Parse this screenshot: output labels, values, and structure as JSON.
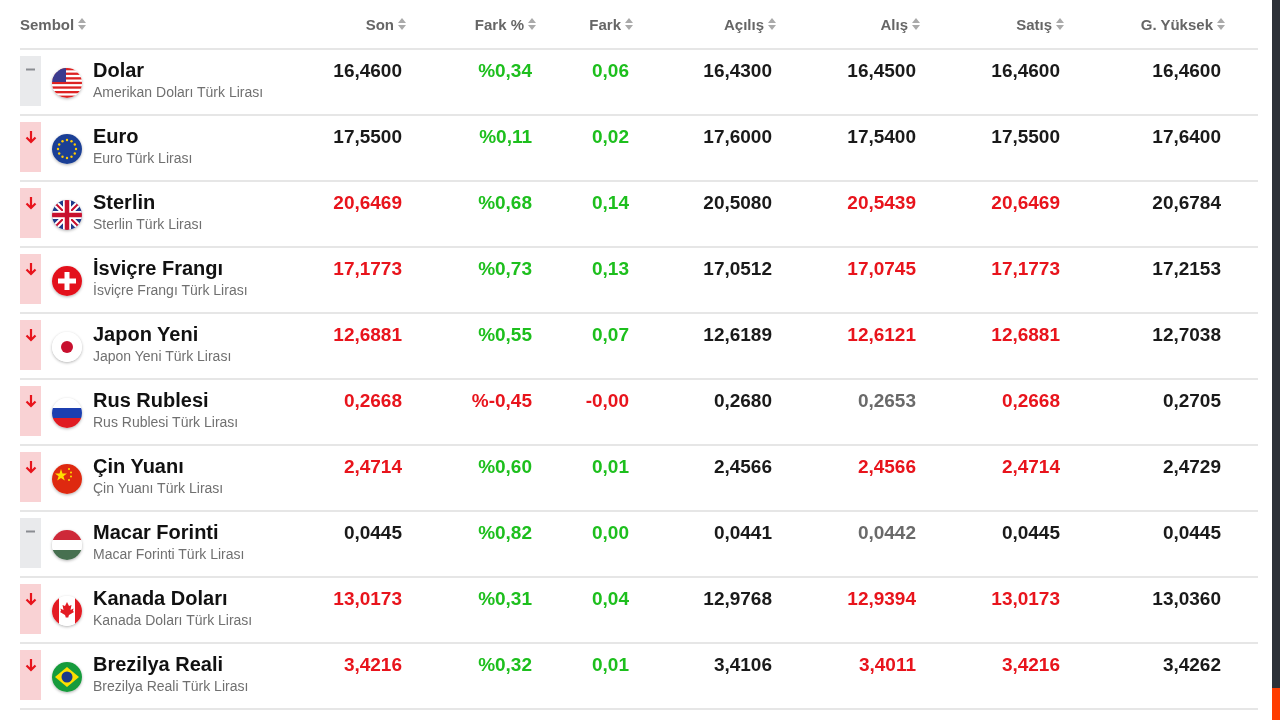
{
  "table": {
    "columns": [
      {
        "label": "Sembol"
      },
      {
        "label": "Son"
      },
      {
        "label": "Fark %"
      },
      {
        "label": "Fark"
      },
      {
        "label": "Açılış"
      },
      {
        "label": "Alış"
      },
      {
        "label": "Satış"
      },
      {
        "label": "G. Yüksek"
      }
    ],
    "rows": [
      {
        "kind": "flat",
        "cells": [
          {
            "text": "Dolar",
            "subtitle": "Amerikan Doları Türk Lirası"
          },
          {
            "text": "16,4600",
            "color": "#1a1a1a"
          },
          {
            "text": "%0,34",
            "color": "#1dbf1d"
          },
          {
            "text": "0,06",
            "color": "#1dbf1d"
          },
          {
            "text": "16,4300",
            "color": "#1a1a1a"
          },
          {
            "text": "16,4500",
            "color": "#1a1a1a"
          },
          {
            "text": "16,4600",
            "color": "#1a1a1a"
          },
          {
            "text": "16,4600",
            "color": "#1a1a1a"
          }
        ]
      },
      {
        "kind": "down",
        "cells": [
          {
            "text": "Euro",
            "subtitle": "Euro Türk Lirası"
          },
          {
            "text": "17,5500",
            "color": "#1a1a1a"
          },
          {
            "text": "%0,11",
            "color": "#1dbf1d"
          },
          {
            "text": "0,02",
            "color": "#1dbf1d"
          },
          {
            "text": "17,6000",
            "color": "#1a1a1a"
          },
          {
            "text": "17,5400",
            "color": "#1a1a1a"
          },
          {
            "text": "17,5500",
            "color": "#1a1a1a"
          },
          {
            "text": "17,6400",
            "color": "#1a1a1a"
          }
        ]
      },
      {
        "kind": "down",
        "cells": [
          {
            "text": "Sterlin",
            "subtitle": "Sterlin Türk Lirası"
          },
          {
            "text": "20,6469",
            "color": "#e8141c"
          },
          {
            "text": "%0,68",
            "color": "#1dbf1d"
          },
          {
            "text": "0,14",
            "color": "#1dbf1d"
          },
          {
            "text": "20,5080",
            "color": "#1a1a1a"
          },
          {
            "text": "20,5439",
            "color": "#e8141c"
          },
          {
            "text": "20,6469",
            "color": "#e8141c"
          },
          {
            "text": "20,6784",
            "color": "#1a1a1a"
          }
        ]
      },
      {
        "kind": "down",
        "cells": [
          {
            "text": "İsviçre Frangı",
            "subtitle": "İsviçre Frangı Türk Lirası"
          },
          {
            "text": "17,1773",
            "color": "#e8141c"
          },
          {
            "text": "%0,73",
            "color": "#1dbf1d"
          },
          {
            "text": "0,13",
            "color": "#1dbf1d"
          },
          {
            "text": "17,0512",
            "color": "#1a1a1a"
          },
          {
            "text": "17,0745",
            "color": "#e8141c"
          },
          {
            "text": "17,1773",
            "color": "#e8141c"
          },
          {
            "text": "17,2153",
            "color": "#1a1a1a"
          }
        ]
      },
      {
        "kind": "down",
        "cells": [
          {
            "text": "Japon Yeni",
            "subtitle": "Japon Yeni Türk Lirası"
          },
          {
            "text": "12,6881",
            "color": "#e8141c"
          },
          {
            "text": "%0,55",
            "color": "#1dbf1d"
          },
          {
            "text": "0,07",
            "color": "#1dbf1d"
          },
          {
            "text": "12,6189",
            "color": "#1a1a1a"
          },
          {
            "text": "12,6121",
            "color": "#e8141c"
          },
          {
            "text": "12,6881",
            "color": "#e8141c"
          },
          {
            "text": "12,7038",
            "color": "#1a1a1a"
          }
        ]
      },
      {
        "kind": "down",
        "cells": [
          {
            "text": "Rus Rublesi",
            "subtitle": "Rus Rublesi Türk Lirası"
          },
          {
            "text": "0,2668",
            "color": "#e8141c"
          },
          {
            "text": "%-0,45",
            "color": "#e8141c"
          },
          {
            "text": "-0,00",
            "color": "#e8141c"
          },
          {
            "text": "0,2680",
            "color": "#1a1a1a"
          },
          {
            "text": "0,2653",
            "color": "#6a6a6a"
          },
          {
            "text": "0,2668",
            "color": "#e8141c"
          },
          {
            "text": "0,2705",
            "color": "#1a1a1a"
          }
        ]
      },
      {
        "kind": "down",
        "cells": [
          {
            "text": "Çin Yuanı",
            "subtitle": "Çin Yuanı Türk Lirası"
          },
          {
            "text": "2,4714",
            "color": "#e8141c"
          },
          {
            "text": "%0,60",
            "color": "#1dbf1d"
          },
          {
            "text": "0,01",
            "color": "#1dbf1d"
          },
          {
            "text": "2,4566",
            "color": "#1a1a1a"
          },
          {
            "text": "2,4566",
            "color": "#e8141c"
          },
          {
            "text": "2,4714",
            "color": "#e8141c"
          },
          {
            "text": "2,4729",
            "color": "#1a1a1a"
          }
        ]
      },
      {
        "kind": "flat",
        "cells": [
          {
            "text": "Macar Forinti",
            "subtitle": "Macar Forinti Türk Lirası"
          },
          {
            "text": "0,0445",
            "color": "#1a1a1a"
          },
          {
            "text": "%0,82",
            "color": "#1dbf1d"
          },
          {
            "text": "0,00",
            "color": "#1dbf1d"
          },
          {
            "text": "0,0441",
            "color": "#1a1a1a"
          },
          {
            "text": "0,0442",
            "color": "#6a6a6a"
          },
          {
            "text": "0,0445",
            "color": "#1a1a1a"
          },
          {
            "text": "0,0445",
            "color": "#1a1a1a"
          }
        ]
      },
      {
        "kind": "down",
        "cells": [
          {
            "text": "Kanada Doları",
            "subtitle": "Kanada Doları Türk Lirası"
          },
          {
            "text": "13,0173",
            "color": "#e8141c"
          },
          {
            "text": "%0,31",
            "color": "#1dbf1d"
          },
          {
            "text": "0,04",
            "color": "#1dbf1d"
          },
          {
            "text": "12,9768",
            "color": "#1a1a1a"
          },
          {
            "text": "12,9394",
            "color": "#e8141c"
          },
          {
            "text": "13,0173",
            "color": "#e8141c"
          },
          {
            "text": "13,0360",
            "color": "#1a1a1a"
          }
        ]
      },
      {
        "kind": "down",
        "cells": [
          {
            "text": "Brezilya Reali",
            "subtitle": "Brezilya Reali Türk Lirası"
          },
          {
            "text": "3,4216",
            "color": "#e8141c"
          },
          {
            "text": "%0,32",
            "color": "#1dbf1d"
          },
          {
            "text": "0,01",
            "color": "#1dbf1d"
          },
          {
            "text": "3,4106",
            "color": "#1a1a1a"
          },
          {
            "text": "3,4011",
            "color": "#e8141c"
          },
          {
            "text": "3,4216",
            "color": "#e8141c"
          },
          {
            "text": "3,4262",
            "color": "#1a1a1a"
          }
        ]
      }
    ]
  }
}
